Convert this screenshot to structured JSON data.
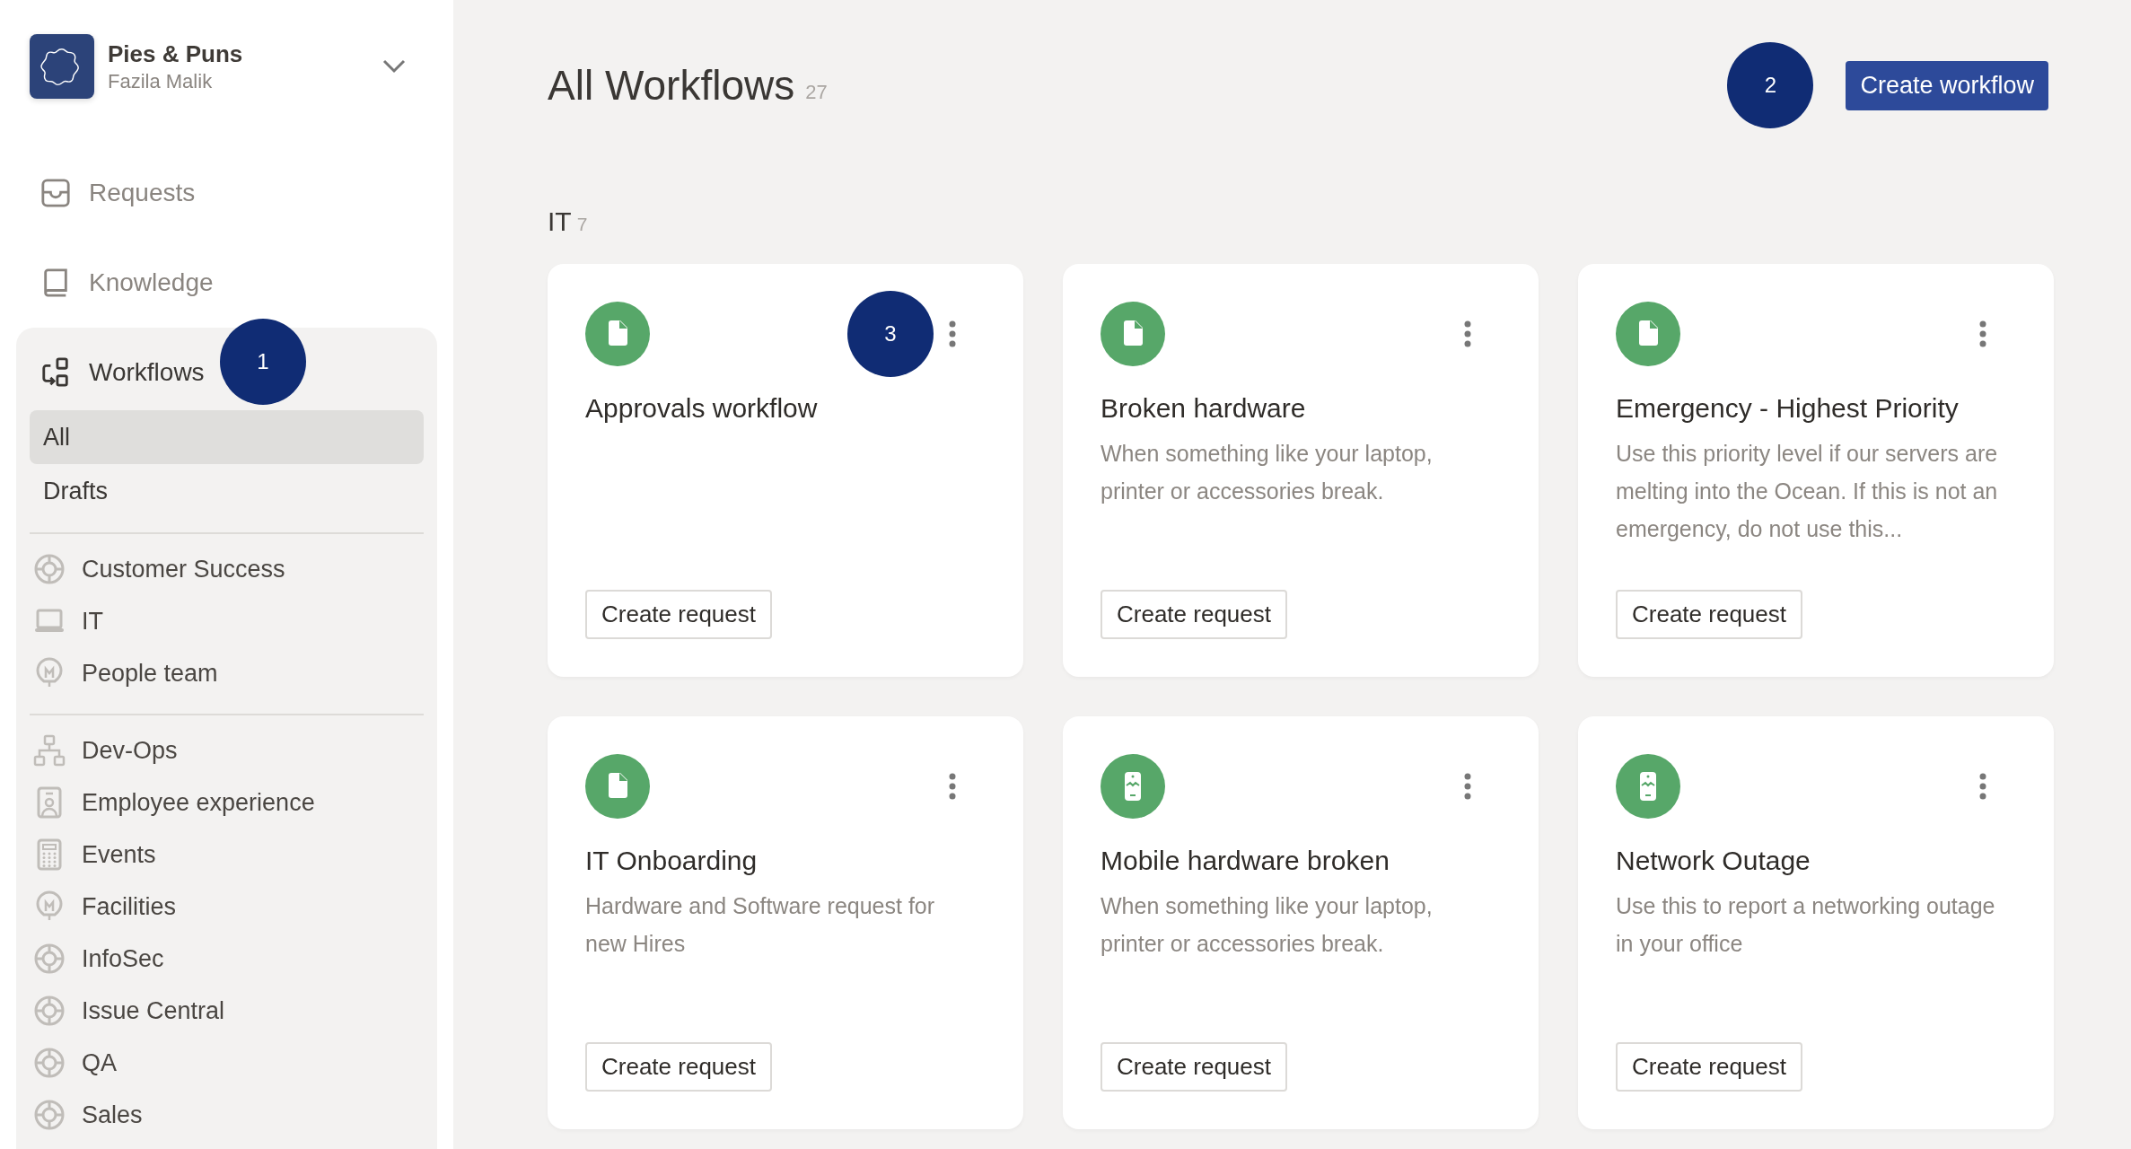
{
  "workspace": {
    "name": "Pies & Puns",
    "user": "Fazila Malik"
  },
  "nav": [
    {
      "label": "Requests",
      "kind": "inbox",
      "selected": false
    },
    {
      "label": "Knowledge",
      "kind": "book",
      "selected": false
    },
    {
      "label": "Workflows",
      "kind": "workflow",
      "selected": true,
      "marker": "1"
    }
  ],
  "workflow_views": [
    {
      "label": "All",
      "selected": true
    },
    {
      "label": "Drafts",
      "selected": false
    }
  ],
  "team_groups": [
    [
      {
        "label": "Customer Success",
        "kind": "lifebuoy"
      },
      {
        "label": "IT",
        "kind": "laptop"
      },
      {
        "label": "People team",
        "kind": "bulb"
      }
    ],
    [
      {
        "label": "Dev-Ops",
        "kind": "network"
      },
      {
        "label": "Employee experience",
        "kind": "badge"
      },
      {
        "label": "Events",
        "kind": "calculator"
      },
      {
        "label": "Facilities",
        "kind": "bulb"
      },
      {
        "label": "InfoSec",
        "kind": "lifebuoy"
      },
      {
        "label": "Issue Central",
        "kind": "lifebuoy"
      },
      {
        "label": "QA",
        "kind": "lifebuoy"
      },
      {
        "label": "Sales",
        "kind": "lifebuoy"
      }
    ]
  ],
  "header": {
    "title": "All Workflows",
    "count": "27",
    "marker": "2",
    "button": "Create workflow"
  },
  "section": {
    "title": "IT",
    "count": "7"
  },
  "cards": [
    {
      "kind": "document",
      "title": "Approvals workflow",
      "marker": "3",
      "button": "Create request"
    },
    {
      "kind": "document",
      "title": "Broken hardware",
      "description": "When something like your laptop, printer or accessories break.",
      "button": "Create request"
    },
    {
      "kind": "document",
      "title": "Emergency - Highest Priority",
      "description": "Use this priority level if our servers are melting into the Ocean. If this is not an emergency, do not use this...",
      "button": "Create request"
    },
    {
      "kind": "document",
      "title": "IT Onboarding",
      "description": "Hardware and Software request for new Hires",
      "button": "Create request"
    },
    {
      "kind": "phone",
      "title": "Mobile hardware broken",
      "description": "When something like your laptop, printer or accessories break.",
      "button": "Create request"
    },
    {
      "kind": "phone",
      "title": "Network Outage",
      "description": "Use this to report a networking outage in your office",
      "button": "Create request"
    }
  ]
}
